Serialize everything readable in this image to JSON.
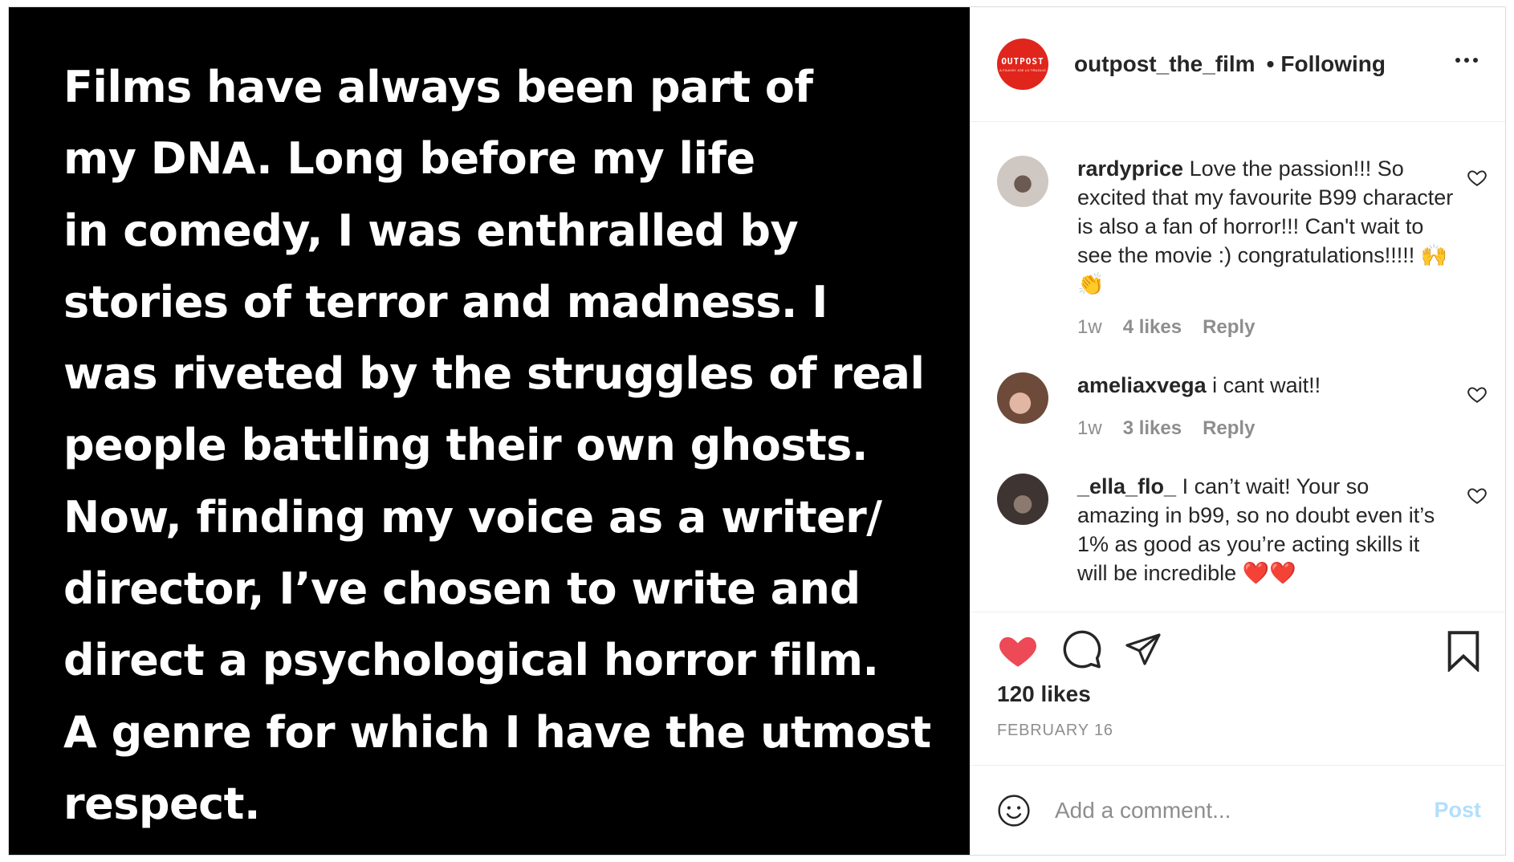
{
  "post": {
    "image_text_lines": [
      "Films have always been part of",
      "my DNA. Long before my life",
      "in comedy, I was enthralled by",
      "stories of terror and madness. I",
      "was riveted by the struggles of real",
      "people battling their own ghosts.",
      "Now, finding my voice as a writer/",
      "director, I’ve chosen to write and",
      "direct a psychological horror film.",
      "A genre for which I have the utmost",
      "respect."
    ]
  },
  "header": {
    "avatar_logo": "OUTPOST",
    "avatar_logo_sub": "A FILM BY JOE LO TRUGLIO",
    "username": "outpost_the_film",
    "separator": "•",
    "follow_status": "Following",
    "more_icon": "more-horizontal-icon"
  },
  "comments": [
    {
      "username": "rardyprice",
      "text": " Love the passion!!! So excited that my favourite B99 character is also a fan of horror!!! Can't wait to see the movie :) congratulations!!!!! 🙌👏",
      "time": "1w",
      "likes": "4 likes",
      "reply": "Reply"
    },
    {
      "username": "ameliaxvega",
      "text": " i cant wait!!",
      "time": "1w",
      "likes": "3 likes",
      "reply": "Reply"
    },
    {
      "username": "_ella_flo_",
      "text": " I can’t wait! Your so amazing in b99, so no doubt even it’s 1% as good as you’re acting skills it will be incredible ❤️❤️",
      "time": "",
      "likes": "",
      "reply": ""
    }
  ],
  "actions": {
    "like_icon": "heart-filled-icon",
    "comment_icon": "comment-icon",
    "share_icon": "paper-plane-icon",
    "save_icon": "bookmark-icon",
    "likes_count": "120 likes",
    "date": "FEBRUARY 16"
  },
  "add_comment": {
    "emoji_icon": "smiley-icon",
    "placeholder": "Add a comment...",
    "post_label": "Post"
  },
  "colors": {
    "like_red": "#ed4956",
    "brand_avatar_red": "#e0261c",
    "post_button_disabled": "#b2dffc",
    "secondary_text": "#8e8e8e"
  }
}
